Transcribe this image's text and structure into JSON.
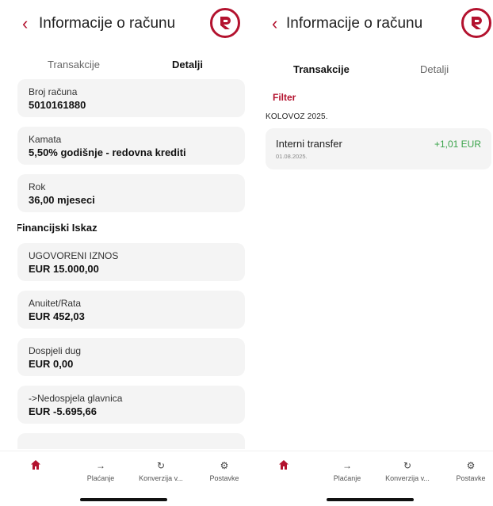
{
  "brand_color": "#b3122e",
  "positive_color": "#3aa34a",
  "left_screen": {
    "header": {
      "back_icon": "chevron-left-icon",
      "title": "Informacije o računu",
      "logo": "bank-logo"
    },
    "tabs": [
      {
        "label": "Transakcije",
        "active": false
      },
      {
        "label": "Detalji",
        "active": true
      }
    ],
    "details": [
      {
        "label": "Broj računa",
        "value": "5010161880"
      },
      {
        "label": "Kamata",
        "value": "5,50% godišnje - redovna krediti"
      },
      {
        "label": "Rok",
        "value": "36,00 mjeseci"
      }
    ],
    "section_title": "Financijski Iskaz",
    "financial": [
      {
        "label": "UGOVORENI IZNOS",
        "value": "EUR 15.000,00"
      },
      {
        "label": "Anuitet/Rata",
        "value": "EUR 452,03"
      },
      {
        "label": "Dospjeli dug",
        "value": "EUR 0,00"
      },
      {
        "label": "->Nedospjela glavnica",
        "value": "EUR -5.695,66"
      }
    ]
  },
  "right_screen": {
    "header": {
      "back_icon": "chevron-left-icon",
      "title": "Informacije o računu",
      "logo": "bank-logo"
    },
    "tabs": [
      {
        "label": "Transakcije",
        "active": true
      },
      {
        "label": "Detalji",
        "active": false
      }
    ],
    "filter_label": "Filter",
    "month_label": "KOLOVOZ 2025.",
    "transactions": [
      {
        "name": "Interni transfer",
        "date": "01.08.2025.",
        "amount": "+1,01 EUR"
      }
    ]
  },
  "bottom_nav": [
    {
      "icon": "home-icon",
      "label": ""
    },
    {
      "icon": "arrow-right-icon",
      "label": "Plaćanje"
    },
    {
      "icon": "refresh-icon",
      "label": "Konverzija v..."
    },
    {
      "icon": "gear-icon",
      "label": "Postavke"
    }
  ]
}
